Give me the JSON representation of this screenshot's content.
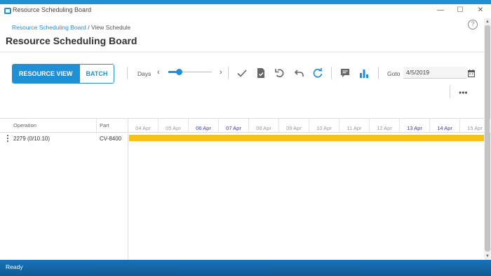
{
  "window": {
    "title": "Resource Scheduling Board",
    "controls": {
      "minimize": "—",
      "maximize": "☐",
      "close": "✕"
    }
  },
  "breadcrumb": {
    "link": "Resource Scheduling Board",
    "separator": "/",
    "current": "View Schedule"
  },
  "page_title": "Resource Scheduling Board",
  "view_toggle": {
    "resource_view": "RESOURCE VIEW",
    "batch": "BATCH",
    "selected": "RESOURCE VIEW"
  },
  "zoom": {
    "label": "Days",
    "prev": "‹",
    "next": "›",
    "level": 0.25
  },
  "toolbar_icons": [
    "checkmark-icon",
    "document-check-icon",
    "undo-icon",
    "undo-all-icon",
    "refresh-icon",
    "comment-icon",
    "bar-chart-icon"
  ],
  "goto": {
    "label": "Goto",
    "value": "4/5/2019"
  },
  "more": "•••",
  "grid": {
    "columns": {
      "operation": "Operation",
      "part": "Part"
    },
    "rows": [
      {
        "operation": "2279 (0/10.10)",
        "part": "CV-8400"
      }
    ]
  },
  "timeline": {
    "dates": [
      {
        "label": "04 Apr",
        "weekend": false
      },
      {
        "label": "05 Apr",
        "weekend": false
      },
      {
        "label": "06 Apr",
        "weekend": true
      },
      {
        "label": "07 Apr",
        "weekend": true
      },
      {
        "label": "08 Apr",
        "weekend": false
      },
      {
        "label": "09 Apr",
        "weekend": false
      },
      {
        "label": "10 Apr",
        "weekend": false
      },
      {
        "label": "11 Apr",
        "weekend": false
      },
      {
        "label": "12 Apr",
        "weekend": false
      },
      {
        "label": "13 Apr",
        "weekend": true
      },
      {
        "label": "14 Apr",
        "weekend": true
      },
      {
        "label": "15 Apr",
        "weekend": false
      }
    ],
    "bar_color": "#f6c21a"
  },
  "status": "Ready",
  "colors": {
    "accent": "#1f8fd6",
    "statusbar": "#1873b8"
  }
}
